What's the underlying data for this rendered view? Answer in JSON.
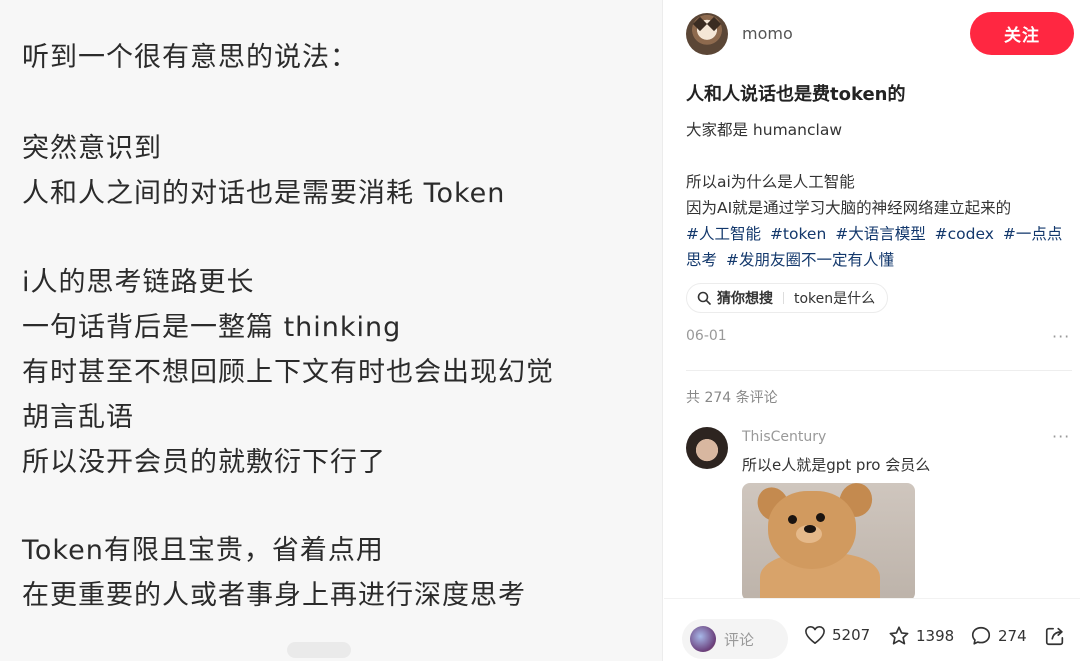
{
  "note": {
    "lines": [
      "听到一个很有意思的说法：",
      "突然意识到",
      "人和人之间的对话也是需要消耗 Token",
      "i人的思考链路更长",
      "一句话背后是一整篇 thinking",
      "有时甚至不想回顾上下文有时也会出现幻觉",
      "胡言乱语",
      "所以没开会员的就敷衍下行了",
      "Token有限且宝贵，省着点用",
      "在更重要的人或者事身上再进行深度思考"
    ]
  },
  "author": {
    "name": "momo",
    "follow_label": "关注"
  },
  "post": {
    "title": "人和人说话也是费token的",
    "body": [
      "大家都是 humanclaw",
      "所以ai为什么是人工智能",
      "因为AI就是通过学习大脑的神经网络建立起来的"
    ],
    "tags_row1": [
      "#人工智能",
      "#token",
      "#大语言模型",
      "#codex",
      "#一点点"
    ],
    "tags_row2": [
      "思考",
      "#发朋友圈不一定有人懂"
    ],
    "guess": {
      "label": "猜你想搜",
      "query": "token是什么"
    },
    "date": "06-01",
    "more": "···"
  },
  "comments": {
    "count_label": "共 274 条评论",
    "items": [
      {
        "user": "ThisCentury",
        "text": "所以e人就是gpt pro 会员么",
        "more": "···"
      }
    ]
  },
  "actions": {
    "comment_placeholder": "评论",
    "likes": "5207",
    "stars": "1398",
    "comments": "274"
  },
  "colors": {
    "accent": "#ff2741",
    "tag": "#13386c"
  },
  "icons": [
    "search-icon",
    "heart-icon",
    "star-icon",
    "comment-icon",
    "share-icon",
    "more-icon"
  ]
}
